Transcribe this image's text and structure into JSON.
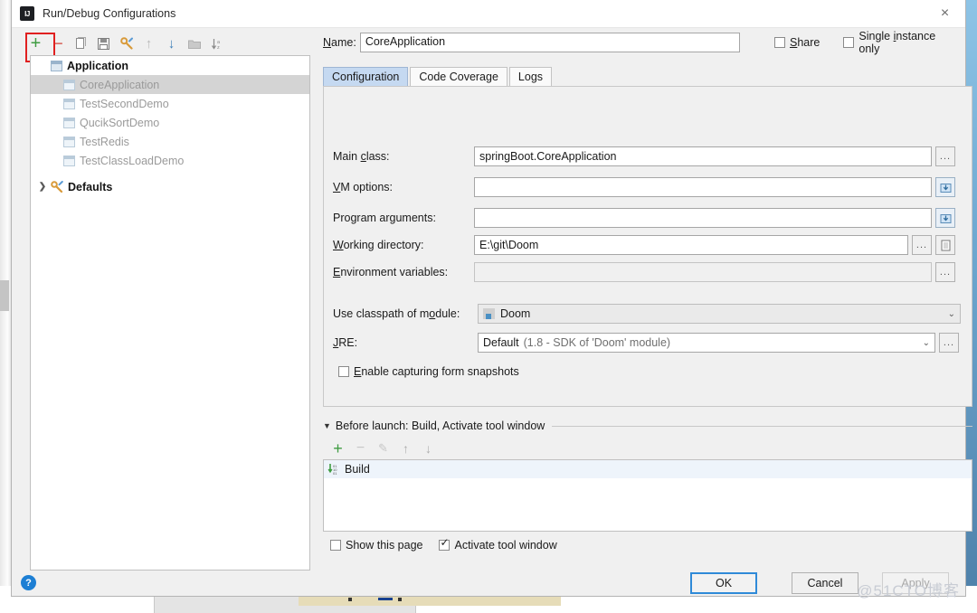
{
  "window": {
    "title": "Run/Debug Configurations",
    "logo_text": "IJ",
    "close_label": "×"
  },
  "left_toolbar": {
    "buttons": [
      {
        "name": "add",
        "glyph": "+",
        "color": "#3f9c42"
      },
      {
        "name": "remove",
        "glyph": "−",
        "color": "#d1493f"
      },
      {
        "name": "copy",
        "glyph": "❐",
        "color": "#8a8a8a"
      },
      {
        "name": "save",
        "glyph": "💾",
        "color": "#7a7a7a"
      },
      {
        "name": "edit-defaults",
        "glyph": "⚒",
        "color": "#d89a3a"
      },
      {
        "name": "move-up",
        "glyph": "↑",
        "color": "#b8b8b8"
      },
      {
        "name": "move-down",
        "glyph": "↓",
        "color": "#3d7fb8"
      },
      {
        "name": "new-folder",
        "glyph": "▬",
        "color": "#b6b6b6"
      },
      {
        "name": "sort-alphabetically",
        "glyph": "↓ᴀ",
        "color": "#8a8a8a"
      }
    ]
  },
  "tree": {
    "groups": [
      {
        "label": "Application",
        "expander": "",
        "children": [
          {
            "label": "CoreApplication",
            "selected": true
          },
          {
            "label": "TestSecondDemo",
            "selected": false
          },
          {
            "label": "QucikSortDemo",
            "selected": false
          },
          {
            "label": "TestRedis",
            "selected": false
          },
          {
            "label": "TestClassLoadDemo",
            "selected": false
          }
        ]
      },
      {
        "label": "Defaults",
        "expander": "❯",
        "children": []
      }
    ]
  },
  "name_row": {
    "label": "Name:",
    "label_mnemonic": "N",
    "value": "CoreApplication",
    "share": {
      "label": "Share",
      "mnemonic": "S",
      "checked": false
    },
    "single_instance": {
      "label": "Single instance only",
      "mnemonic": "i",
      "checked": false
    }
  },
  "tabs": [
    {
      "label": "Configuration",
      "active": true
    },
    {
      "label": "Code Coverage",
      "active": false
    },
    {
      "label": "Logs",
      "active": false
    }
  ],
  "config": {
    "main_class": {
      "label": "Main class:",
      "value": "springBoot.CoreApplication",
      "browse": "..."
    },
    "vm_options": {
      "label": "VM options:",
      "value": "",
      "expand": "expand-icon"
    },
    "program_arguments": {
      "label": "Program arguments:",
      "value": "",
      "expand": "expand-icon"
    },
    "working_directory": {
      "label": "Working directory:",
      "value": "E:\\git\\Doom",
      "browse": "...",
      "macro": "macro-icon"
    },
    "environment_variables": {
      "label": "Environment variables:",
      "value": "",
      "browse": "..."
    },
    "use_classpath_of_module": {
      "label": "Use classpath of module:",
      "value": "Doom"
    },
    "jre": {
      "label": "JRE:",
      "value": "Default",
      "hint": "(1.8 - SDK of 'Doom' module)",
      "browse": "..."
    },
    "enable_capturing": {
      "label": "Enable capturing form snapshots",
      "mnemonic": "E",
      "checked": false
    }
  },
  "before_launch": {
    "header": "Before launch: Build, Activate tool window",
    "toolbar": [
      {
        "name": "add-task",
        "glyph": "+",
        "color": "#3f9c42"
      },
      {
        "name": "remove-task",
        "glyph": "−",
        "color": "#c0c0c0"
      },
      {
        "name": "edit-task",
        "glyph": "✎",
        "color": "#c0c0c0"
      },
      {
        "name": "move-task-up",
        "glyph": "↑",
        "color": "#a8a8a8"
      },
      {
        "name": "move-task-down",
        "glyph": "↓",
        "color": "#a8a8a8"
      }
    ],
    "items": [
      {
        "label": "Build",
        "icon": "build-icon"
      }
    ],
    "show_this_page": {
      "label": "Show this page",
      "checked": false
    },
    "activate_tool_window": {
      "label": "Activate tool window",
      "checked": true
    }
  },
  "footer": {
    "help": "?",
    "ok": "OK",
    "cancel": "Cancel",
    "apply": "Apply",
    "watermark": "@51CTO博客"
  }
}
